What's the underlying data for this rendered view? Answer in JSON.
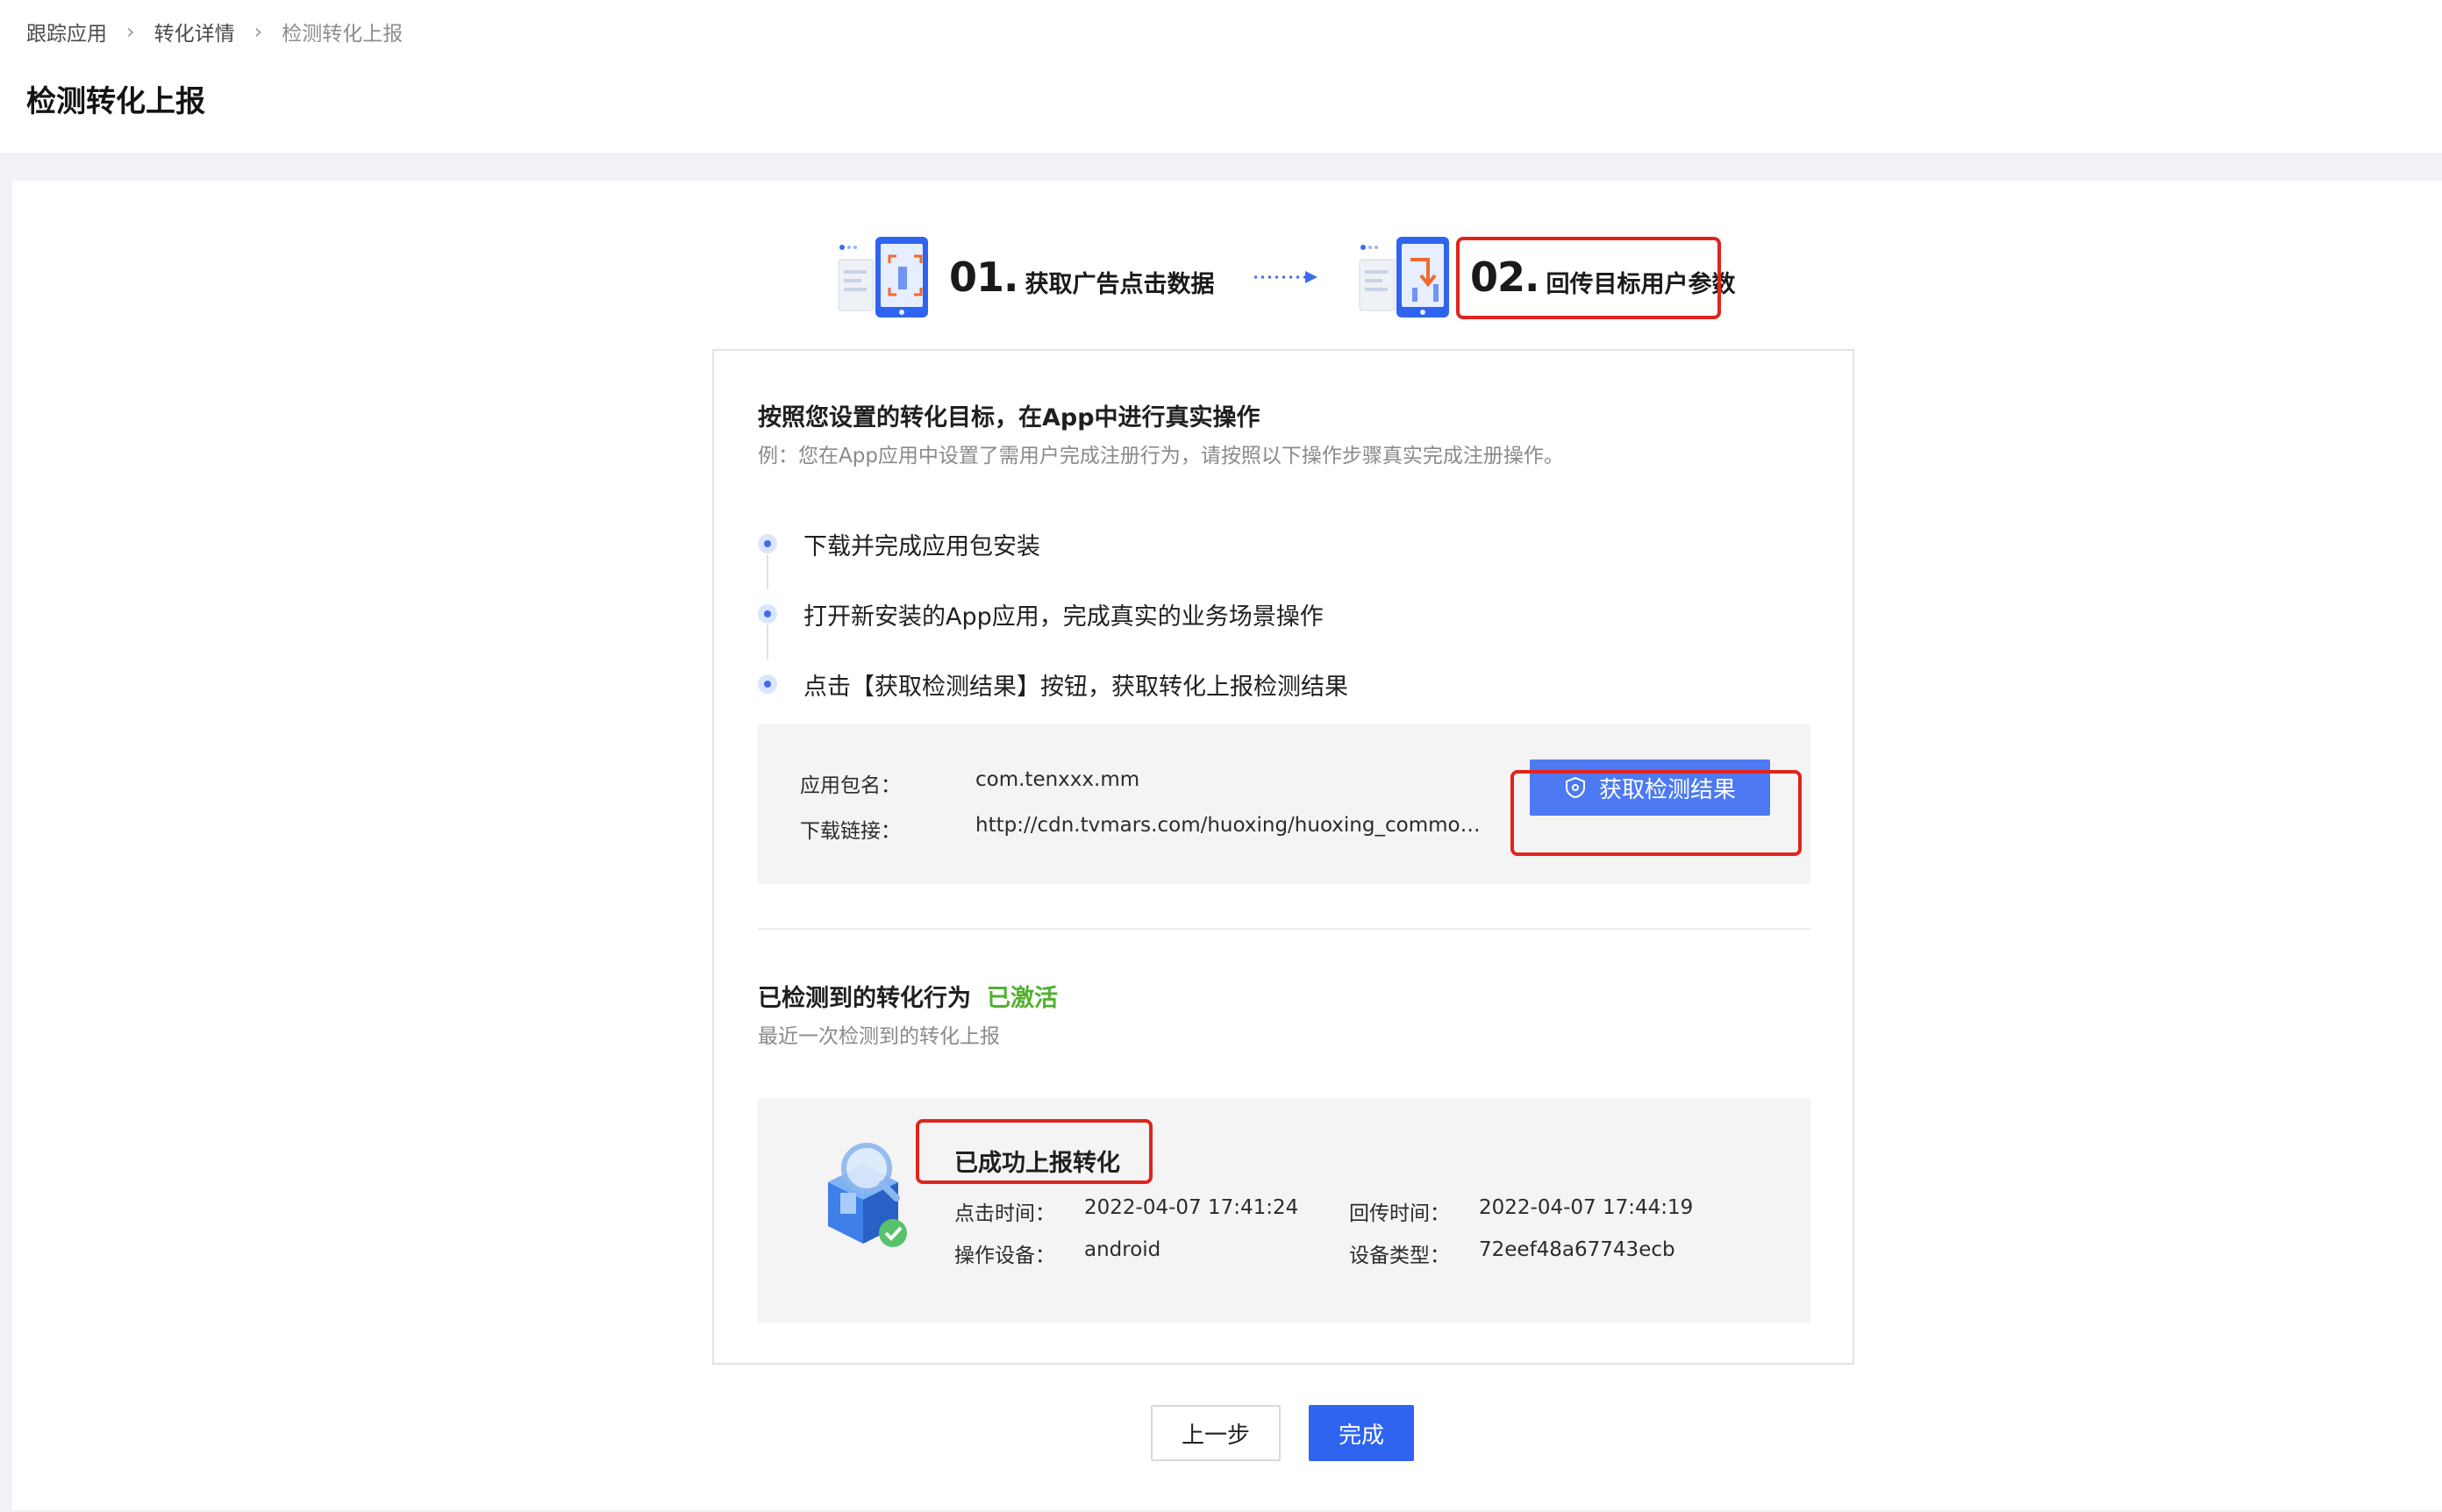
{
  "breadcrumb": {
    "items": [
      "跟踪应用",
      "转化详情",
      "检测转化上报"
    ]
  },
  "page_title": "检测转化上报",
  "steps": [
    {
      "num": "01.",
      "label": "获取广告点击数据"
    },
    {
      "num": "02.",
      "label": "回传目标用户参数"
    }
  ],
  "guide": {
    "title": "按照您设置的转化目标，在App中进行真实操作",
    "subtitle": "例：您在App应用中设置了需用户完成注册行为，请按照以下操作步骤真实完成注册操作。",
    "steps": [
      "下载并完成应用包安装",
      "打开新安装的App应用，完成真实的业务场景操作",
      "点击【获取检测结果】按钮，获取转化上报检测结果"
    ]
  },
  "app_info": {
    "package_label": "应用包名：",
    "package_value": "com.tenxxx.mm",
    "download_label": "下载链接：",
    "download_value": "http://cdn.tvmars.com/huoxing/huoxing_common_...",
    "get_result_button": "获取检测结果"
  },
  "detected": {
    "title": "已检测到的转化行为",
    "status": "已激活",
    "subtitle": "最近一次检测到的转化上报"
  },
  "result": {
    "title": "已成功上报转化",
    "click_time_label": "点击时间：",
    "click_time_value": "2022-04-07 17:41:24",
    "callback_time_label": "回传时间：",
    "callback_time_value": "2022-04-07 17:44:19",
    "device_label": "操作设备：",
    "device_value": "android",
    "device_type_label": "设备类型：",
    "device_type_value": "72eef48a67743ecb"
  },
  "footer": {
    "prev_button": "上一步",
    "done_button": "完成"
  },
  "colors": {
    "primary": "#2f64f0",
    "button_blue": "#4d7af2",
    "highlight_red": "#e0241c",
    "success_green": "#52b02f"
  }
}
